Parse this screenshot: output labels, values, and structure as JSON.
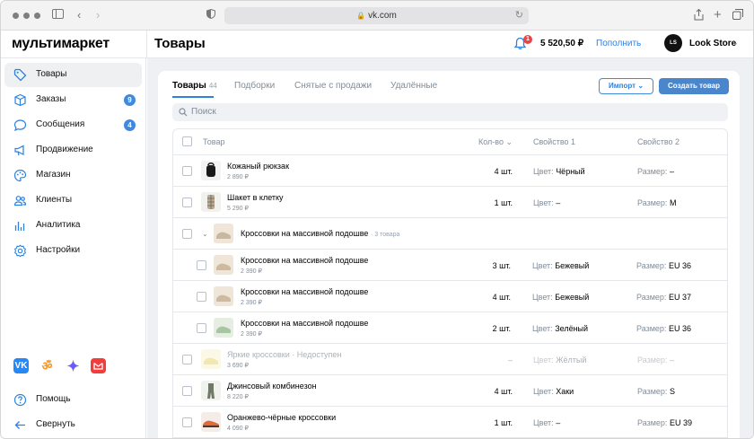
{
  "browser": {
    "url": "vk.com"
  },
  "header": {
    "logo": "мультимаркет",
    "page_title": "Товары",
    "notification_count": "1",
    "balance": "5 520,50 ₽",
    "topup_label": "Пополнить",
    "store_name": "Look Store",
    "store_avatar_text": "LS"
  },
  "sidebar": {
    "items": [
      {
        "label": "Товары",
        "icon": "tag-icon",
        "active": true
      },
      {
        "label": "Заказы",
        "icon": "box-icon",
        "badge": "9"
      },
      {
        "label": "Сообщения",
        "icon": "chat-icon",
        "badge": "4"
      },
      {
        "label": "Продвижение",
        "icon": "megaphone-icon"
      },
      {
        "label": "Магазин",
        "icon": "palette-icon"
      },
      {
        "label": "Клиенты",
        "icon": "users-icon"
      },
      {
        "label": "Аналитика",
        "icon": "chart-icon"
      },
      {
        "label": "Настройки",
        "icon": "gear-icon"
      }
    ],
    "help_label": "Помощь",
    "collapse_label": "Свернуть"
  },
  "toolbar": {
    "tabs": [
      {
        "label": "Товары",
        "count": "44",
        "active": true
      },
      {
        "label": "Подборки"
      },
      {
        "label": "Снятые с продажи"
      },
      {
        "label": "Удалённые"
      }
    ],
    "import_label": "Импорт",
    "create_label": "Создать товар",
    "search_placeholder": "Поиск"
  },
  "table": {
    "columns": {
      "product": "Товар",
      "qty": "Кол-во",
      "prop1": "Свойство 1",
      "prop2": "Свойство 2"
    },
    "rows": [
      {
        "name": "Кожаный рюкзак",
        "price": "2 890 ₽",
        "qty": "4 шт.",
        "p1_label": "Цвет:",
        "p1": "Чёрный",
        "p2_label": "Размер:",
        "p2": "–"
      },
      {
        "name": "Шакет в клетку",
        "price": "5 290 ₽",
        "qty": "1 шт.",
        "p1_label": "Цвет:",
        "p1": "–",
        "p2_label": "Размер:",
        "p2": "M"
      },
      {
        "name": "Кроссовки на массивной подошве",
        "sub": "· 3 товара",
        "group": true
      },
      {
        "name": "Кроссовки на массивной подошве",
        "price": "2 390 ₽",
        "qty": "3 шт.",
        "p1_label": "Цвет:",
        "p1": "Бежевый",
        "p2_label": "Размер:",
        "p2": "EU 36"
      },
      {
        "name": "Кроссовки на массивной подошве",
        "price": "2 390 ₽",
        "qty": "4 шт.",
        "p1_label": "Цвет:",
        "p1": "Бежевый",
        "p2_label": "Размер:",
        "p2": "EU 37"
      },
      {
        "name": "Кроссовки на массивной подошве",
        "price": "2 390 ₽",
        "qty": "2 шт.",
        "p1_label": "Цвет:",
        "p1": "Зелёный",
        "p2_label": "Размер:",
        "p2": "EU 36"
      },
      {
        "name": "Яркие кроссовки · Недоступен",
        "price": "3 690 ₽",
        "qty": "–",
        "p1_label": "Цвет:",
        "p1": "Жёлтый",
        "p2_label": "Размер:",
        "p2": "–",
        "dim": true
      },
      {
        "name": "Джинсовый комбинезон",
        "price": "8 220 ₽",
        "qty": "4 шт.",
        "p1_label": "Цвет:",
        "p1": "Хаки",
        "p2_label": "Размер:",
        "p2": "S"
      },
      {
        "name": "Оранжево-чёрные кроссовки",
        "price": "4 090 ₽",
        "qty": "1 шт.",
        "p1_label": "Цвет:",
        "p1": "–",
        "p2_label": "Размер:",
        "p2": "EU 39"
      }
    ]
  },
  "colors": {
    "accent": "#2d81e0",
    "badge": "#3f8ae0",
    "notify": "#e64646",
    "bg": "#eef0f3"
  }
}
